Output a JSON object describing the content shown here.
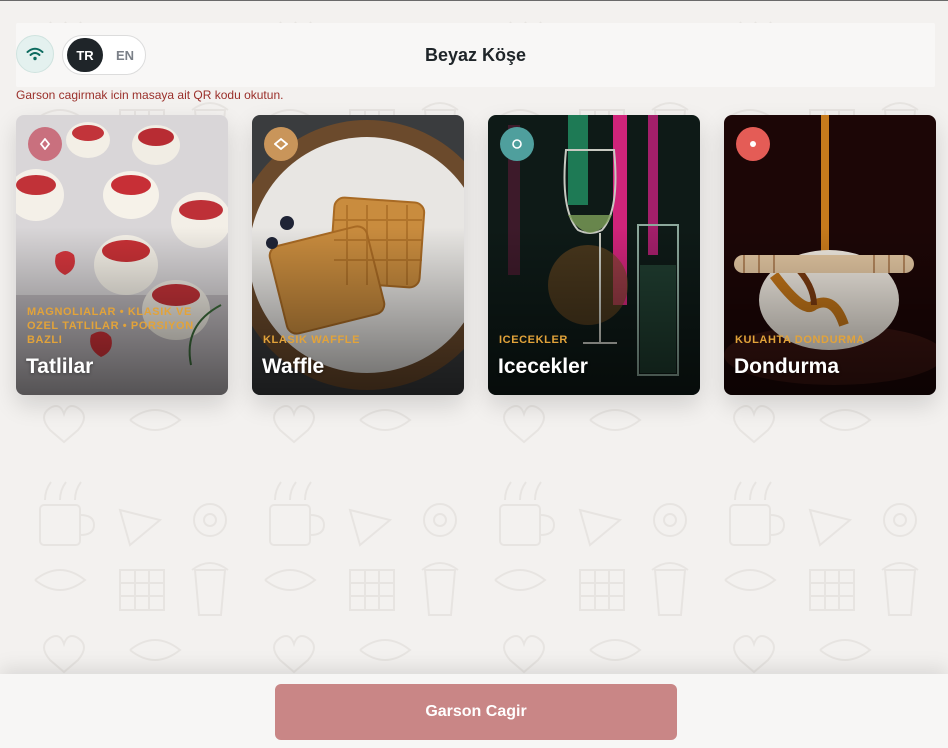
{
  "header": {
    "title": "Beyaz Köşe",
    "wifi_icon": "wifi-icon",
    "languages": [
      {
        "code": "TR",
        "active": true
      },
      {
        "code": "EN",
        "active": false
      }
    ]
  },
  "notice": "Garson cagirmak icin masaya ait QR kodu okutun.",
  "categories": [
    {
      "title": "Tatlilar",
      "subtitle": "MAGNOLIALAR • KLASIK VE OZEL TATLILAR • PORSIYON BAZLI",
      "badge_color": "#c9707e",
      "icon": "diamond-icon"
    },
    {
      "title": "Waffle",
      "subtitle": "KLASIK WAFFLE",
      "badge_color": "#c9955a",
      "icon": "eye-diamond-icon"
    },
    {
      "title": "Icecekler",
      "subtitle": "ICECEKLER",
      "badge_color": "#4f9f9d",
      "icon": "circle-outline-icon"
    },
    {
      "title": "Dondurma",
      "subtitle": "KULAHTA DONDURMA",
      "badge_color": "#e45c56",
      "icon": "dot-icon"
    }
  ],
  "footer": {
    "call_button": "Garson Cagir"
  },
  "colors": {
    "accent": "#c98686",
    "subtitle": "#e2a33a",
    "notice": "#9a2f2a",
    "dark": "#1f2529"
  }
}
